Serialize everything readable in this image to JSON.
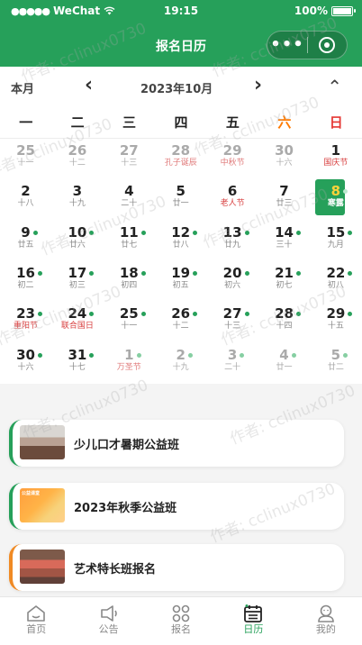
{
  "status_bar": {
    "carrier": "WeChat",
    "time": "19:15",
    "battery": "100%"
  },
  "nav": {
    "title": "报名日历",
    "more_icon": "•••",
    "close_icon": "close-circle-icon"
  },
  "calendar": {
    "mode_label": "本月",
    "month_label": "2023年10月",
    "prev_icon": "‹",
    "next_icon": "›",
    "collapse_icon": "⌃",
    "weekdays": [
      "一",
      "二",
      "三",
      "四",
      "五",
      "六",
      "日"
    ],
    "weeks": [
      [
        {
          "n": "25",
          "l": "十一",
          "o": true
        },
        {
          "n": "26",
          "l": "十二",
          "o": true
        },
        {
          "n": "27",
          "l": "十三",
          "o": true
        },
        {
          "n": "28",
          "l": "孔子诞辰",
          "o": true,
          "f": true,
          "wrap": true
        },
        {
          "n": "29",
          "l": "中秋节",
          "o": true,
          "f": true
        },
        {
          "n": "30",
          "l": "十六",
          "o": true
        },
        {
          "n": "1",
          "l": "国庆节",
          "f": true
        }
      ],
      [
        {
          "n": "2",
          "l": "十八"
        },
        {
          "n": "3",
          "l": "十九"
        },
        {
          "n": "4",
          "l": "二十"
        },
        {
          "n": "5",
          "l": "廿一"
        },
        {
          "n": "6",
          "l": "老人节",
          "f": true
        },
        {
          "n": "7",
          "l": "廿三"
        },
        {
          "n": "8",
          "l": "寒露",
          "today": true,
          "dot": true
        }
      ],
      [
        {
          "n": "9",
          "l": "廿五",
          "dot": true
        },
        {
          "n": "10",
          "l": "廿六",
          "dot": true
        },
        {
          "n": "11",
          "l": "廿七",
          "dot": true
        },
        {
          "n": "12",
          "l": "廿八",
          "dot": true
        },
        {
          "n": "13",
          "l": "廿九",
          "dot": true
        },
        {
          "n": "14",
          "l": "三十",
          "dot": true
        },
        {
          "n": "15",
          "l": "九月",
          "dot": true
        }
      ],
      [
        {
          "n": "16",
          "l": "初二",
          "dot": true
        },
        {
          "n": "17",
          "l": "初三",
          "dot": true
        },
        {
          "n": "18",
          "l": "初四",
          "dot": true
        },
        {
          "n": "19",
          "l": "初五",
          "dot": true
        },
        {
          "n": "20",
          "l": "初六",
          "dot": true
        },
        {
          "n": "21",
          "l": "初七",
          "dot": true
        },
        {
          "n": "22",
          "l": "初八",
          "dot": true
        }
      ],
      [
        {
          "n": "23",
          "l": "重阳节",
          "f": true,
          "dot": true
        },
        {
          "n": "24",
          "l": "联合国日",
          "f": true,
          "dot": true,
          "wrap": true
        },
        {
          "n": "25",
          "l": "十一",
          "dot": true
        },
        {
          "n": "26",
          "l": "十二",
          "dot": true
        },
        {
          "n": "27",
          "l": "十三",
          "dot": true
        },
        {
          "n": "28",
          "l": "十四",
          "dot": true
        },
        {
          "n": "29",
          "l": "十五",
          "dot": true
        }
      ],
      [
        {
          "n": "30",
          "l": "十六",
          "dot": true
        },
        {
          "n": "31",
          "l": "十七",
          "dot": true
        },
        {
          "n": "1",
          "l": "万圣节",
          "o": true,
          "f": true,
          "dot": true
        },
        {
          "n": "2",
          "l": "十九",
          "o": true,
          "dot": true
        },
        {
          "n": "3",
          "l": "二十",
          "o": true,
          "dot": true
        },
        {
          "n": "4",
          "l": "廿一",
          "o": true,
          "dot": true
        },
        {
          "n": "5",
          "l": "廿二",
          "o": true,
          "dot": true
        }
      ]
    ]
  },
  "events": [
    {
      "title": "少儿口才暑期公益班",
      "accent": "#26a05a"
    },
    {
      "title": "2023年秋季公益班",
      "accent": "#26a05a",
      "thumb_text": "公益课堂"
    },
    {
      "title": "艺术特长班报名",
      "accent": "#f08a24"
    }
  ],
  "tabbar": [
    {
      "label": "首页",
      "icon": "home-icon"
    },
    {
      "label": "公告",
      "icon": "announcement-icon"
    },
    {
      "label": "报名",
      "icon": "grid-icon"
    },
    {
      "label": "日历",
      "icon": "calendar-icon",
      "active": true
    },
    {
      "label": "我的",
      "icon": "profile-icon"
    }
  ],
  "watermark": "作者: cclinux0730",
  "colors": {
    "primary": "#26a05a",
    "festival": "#d84040",
    "saturday": "#ff7a00",
    "sunday": "#e53935",
    "today_number": "#ffd23a"
  }
}
